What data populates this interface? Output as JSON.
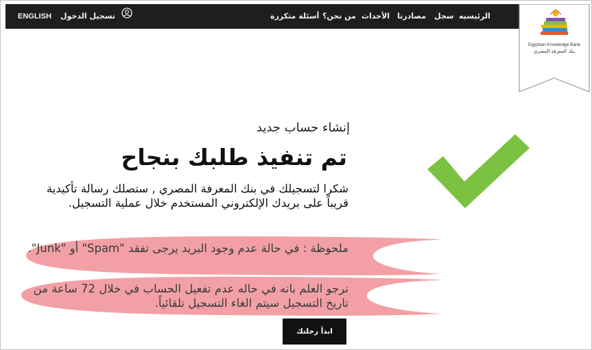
{
  "nav": {
    "language_label": "ENGLISH",
    "login_label": "تسجيل الدخول",
    "items": [
      {
        "label": "الرئيسيه"
      },
      {
        "label": "سجل"
      },
      {
        "label": "مصادرنا"
      },
      {
        "label": "الأحداث"
      },
      {
        "label": "من نحن؟"
      },
      {
        "label": "أسئلة متكررة"
      }
    ]
  },
  "logo": {
    "english_text": "Egyptian Knowledge Bank",
    "arabic_text": "بنك المعرفة المصري"
  },
  "content": {
    "subtitle": "إنشاء حساب جديد",
    "headline": "تم تنفيذ طلبك بنجاح",
    "message": "شكرا لتسجيلك في بنك المعرفة المصري , ستصلك رسالة تأكيدية قريباً على بريدك الإلكتروني المستخدم خلال عملية التسجيل.",
    "note_spam": "ملحوظة : في حالة عدم وجود البريد يرجى تفقد \"Spam\" أو \"Junk\".",
    "note_expiry": "نرجو العلم بانه في حاله عدم تفعيل الحساب في خلال 72 ساعة من تاريخ التسجيل سيتم الغاء التسجيل تلقائياً.",
    "start_button_label": "ابدأ رحلتك"
  },
  "colors": {
    "nav_background": "#1e1e1e",
    "highlight": "#f2a0a6",
    "checkmark": "#7cc242",
    "button_background": "#111111"
  },
  "icons": [
    "user-icon",
    "checkmark-icon",
    "books-logo-icon"
  ]
}
